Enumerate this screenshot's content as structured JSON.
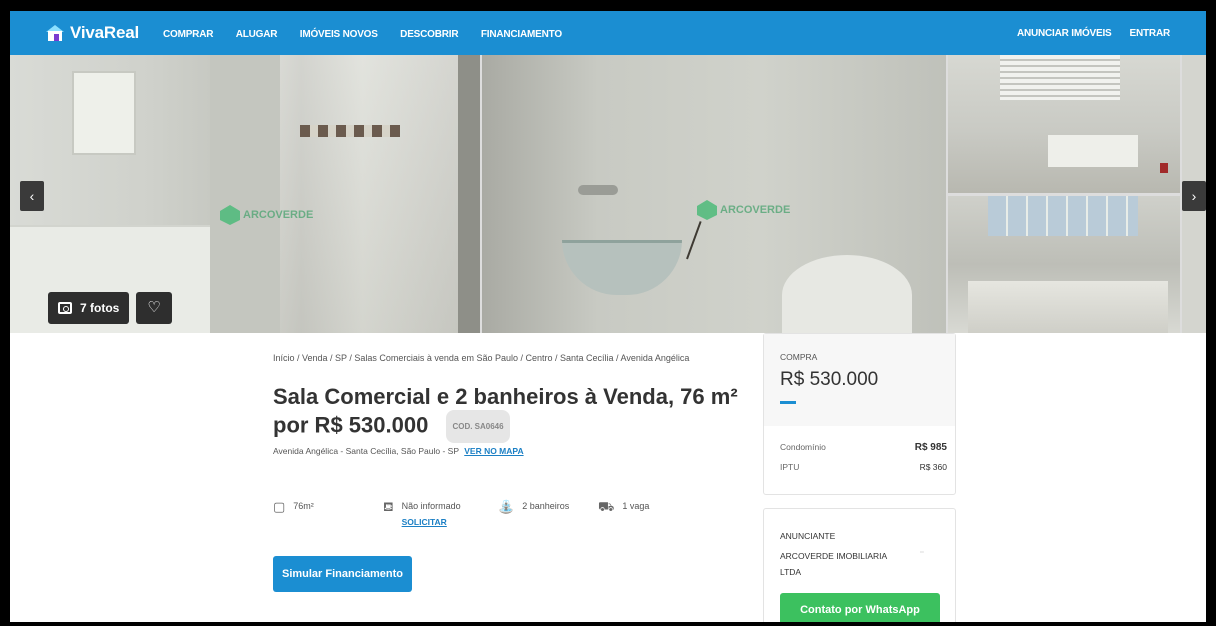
{
  "header": {
    "logo_text": "VivaReal",
    "nav": [
      "COMPRAR",
      "ALUGAR",
      "IMÓVEIS NOVOS",
      "DESCOBRIR",
      "FINANCIAMENTO"
    ],
    "nav_right": [
      "ANUNCIAR IMÓVEIS",
      "ENTRAR"
    ]
  },
  "gallery": {
    "photo_count": "7 fotos",
    "watermark": "ARCOVERDE",
    "prev_icon": "‹",
    "next_icon": "›",
    "favorite_icon": "♡"
  },
  "breadcrumb": "Início / Venda / SP / Salas Comerciais à venda em São Paulo / Centro / Santa Cecília / Avenida Angélica",
  "listing": {
    "title_line1": "Sala Comercial e 2 banheiros à Venda, 76 m²",
    "title_line2": "por R$ 530.000",
    "code": "COD. SA0646",
    "address": "Avenida Angélica - Santa Cecília, São Paulo - SP",
    "map_link": "VER NO MAPA"
  },
  "features": {
    "area": "76m²",
    "rooms": "Não informado",
    "rooms_action": "SOLICITAR",
    "bathrooms": "2 banheiros",
    "parking": "1 vaga"
  },
  "simulate_button": "Simular Financiamento",
  "price_card": {
    "label": "COMPRA",
    "value": "R$ 530.000",
    "condo_label": "Condomínio",
    "condo_value": "R$ 985",
    "iptu_label": "IPTU",
    "iptu_value": "R$ 360"
  },
  "advertiser": {
    "label": "ANUNCIANTE",
    "name": "ARCOVERDE IMOBILIARIA LTDA",
    "whatsapp_button": "Contato por WhatsApp"
  },
  "colors": {
    "brand": "#1b8ed2",
    "whatsapp": "#3cc15f",
    "link": "#1b7fc4"
  }
}
